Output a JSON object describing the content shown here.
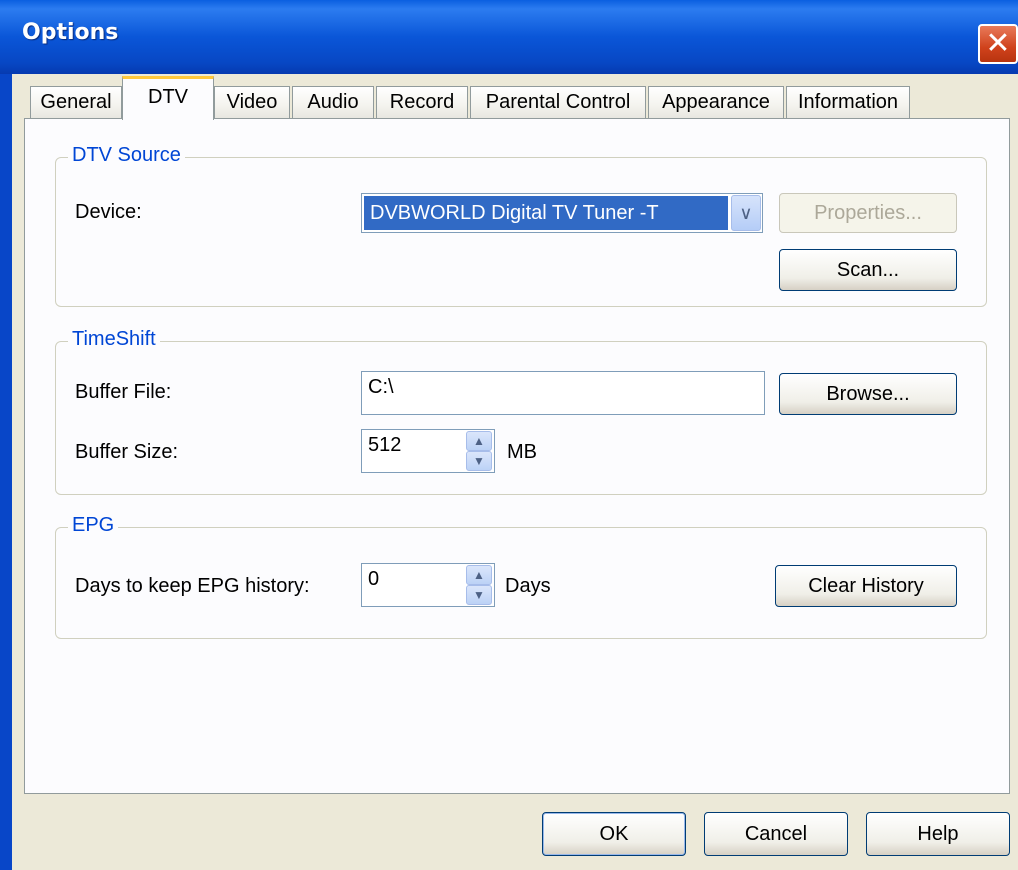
{
  "window": {
    "title": "Options",
    "close_glyph": "✕"
  },
  "tabs": [
    {
      "label": "General"
    },
    {
      "label": "DTV",
      "active": true
    },
    {
      "label": "Video"
    },
    {
      "label": "Audio"
    },
    {
      "label": "Record"
    },
    {
      "label": "Parental Control"
    },
    {
      "label": "Appearance"
    },
    {
      "label": "Information"
    }
  ],
  "dtv_source": {
    "legend": "DTV Source",
    "device_label": "Device:",
    "device_value": "DVBWORLD Digital TV Tuner -T",
    "properties_button": "Properties...",
    "scan_button": "Scan..."
  },
  "timeshift": {
    "legend": "TimeShift",
    "buffer_file_label": "Buffer File:",
    "buffer_file_value": "C:\\",
    "browse_button": "Browse...",
    "buffer_size_label": "Buffer Size:",
    "buffer_size_value": "512",
    "buffer_size_unit": "MB"
  },
  "epg": {
    "legend": "EPG",
    "days_label": "Days to keep EPG history:",
    "days_value": "0",
    "days_unit": "Days",
    "clear_button": "Clear History"
  },
  "footer": {
    "ok": "OK",
    "cancel": "Cancel",
    "help": "Help"
  },
  "icons": {
    "combo_arrow": "chevron-down-icon",
    "spin_up": "arrow-up-icon",
    "spin_down": "arrow-down-icon"
  }
}
